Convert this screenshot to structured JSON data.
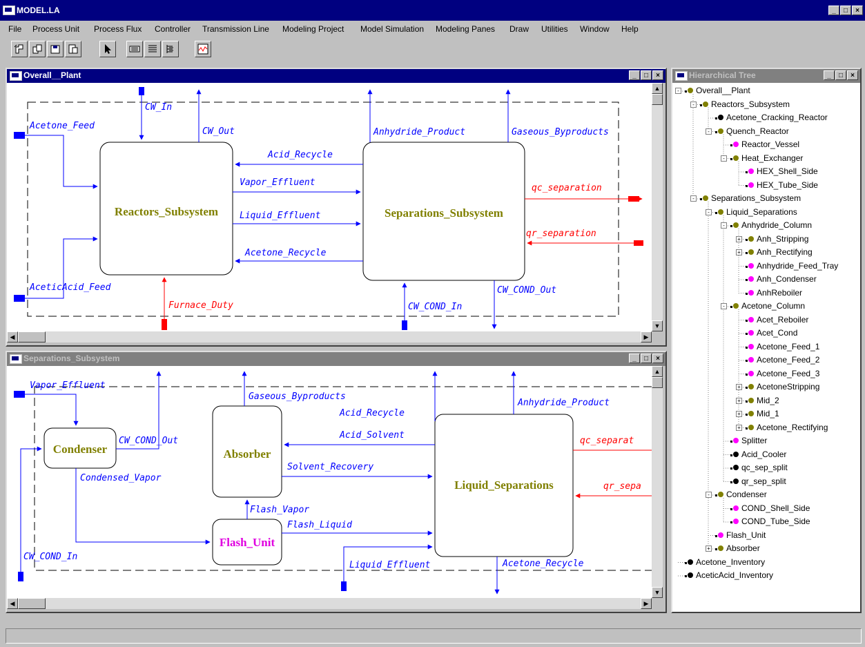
{
  "app": {
    "title": "MODEL.LA"
  },
  "menu": [
    "File",
    "Process Unit",
    "Process Flux",
    "Controller",
    "Transmission Line",
    "Modeling Project",
    "Model Simulation",
    "Modeling Panes",
    "Draw",
    "Utilities",
    "Window",
    "Help"
  ],
  "toolbar": [
    "new-icon",
    "open-icon",
    "save-icon",
    "save-as-icon",
    "pointer-icon",
    "keyboard-icon",
    "list-icon",
    "tree-icon",
    "plot-icon"
  ],
  "colors": {
    "stream": "#0000ff",
    "energy": "#ff0000",
    "unit_label": "#808000",
    "flash_label": "#e000e0",
    "title_active": "#000080",
    "title_inactive": "#808080"
  },
  "win1": {
    "title": "Overall__Plant",
    "units": {
      "reactors": "Reactors_Subsystem",
      "separations": "Separations_Subsystem"
    },
    "streams": {
      "cw_in": "CW_In",
      "cw_out": "CW_Out",
      "acetone_feed": "Acetone_Feed",
      "aceticacid_feed": "AceticAcid_Feed",
      "furnace_duty": "Furnace_Duty",
      "acid_recycle": "Acid_Recycle",
      "vapor_effluent": "Vapor_Effluent",
      "liquid_effluent": "Liquid_Effluent",
      "acetone_recycle": "Acetone_Recycle",
      "anhydride_product": "Anhydride_Product",
      "gaseous_byproducts": "Gaseous_Byproducts",
      "qc_separation": "qc_separation",
      "qr_separation": "qr_separation",
      "cw_cond_in": "CW_COND_In",
      "cw_cond_out": "CW_COND_Out"
    }
  },
  "win2": {
    "title": "Separations_Subsystem",
    "units": {
      "condenser": "Condenser",
      "absorber": "Absorber",
      "flash": "Flash_Unit",
      "liquid_sep": "Liquid_Separations"
    },
    "streams": {
      "vapor_effluent": "Vapor_Effluent",
      "gaseous_byproducts": "Gaseous_Byproducts",
      "acid_recycle": "Acid_Recycle",
      "anhydride_product": "Anhydride_Product",
      "cw_cond_out": "CW_COND_Out",
      "acid_solvent": "Acid_Solvent",
      "qc_separat": "qc_separat",
      "condensed_vapor": "Condensed_Vapor",
      "solvent_recovery": "Solvent_Recovery",
      "qr_sepa": "qr_sepa",
      "flash_vapor": "Flash_Vapor",
      "flash_liquid": "Flash_Liquid",
      "cw_cond_in": "CW_COND_In",
      "liquid_effluent": "Liquid_Effluent",
      "acetone_recycle": "Acetone_Recycle"
    }
  },
  "tree": {
    "title": "Hierarchical Tree",
    "nodes": [
      {
        "label": "Overall__Plant",
        "level": 0,
        "color": "#808000",
        "expanded": true
      },
      {
        "label": "Reactors_Subsystem",
        "level": 1,
        "color": "#808000",
        "expanded": true
      },
      {
        "label": "Acetone_Cracking_Reactor",
        "level": 2,
        "color": "#000000"
      },
      {
        "label": "Quench_Reactor",
        "level": 2,
        "color": "#808000",
        "expanded": true
      },
      {
        "label": "Reactor_Vessel",
        "level": 3,
        "color": "#ff00ff"
      },
      {
        "label": "Heat_Exchanger",
        "level": 3,
        "color": "#808000",
        "expanded": true
      },
      {
        "label": "HEX_Shell_Side",
        "level": 4,
        "color": "#ff00ff"
      },
      {
        "label": "HEX_Tube_Side",
        "level": 4,
        "color": "#ff00ff"
      },
      {
        "label": "Separations_Subsystem",
        "level": 1,
        "color": "#808000",
        "expanded": true
      },
      {
        "label": "Liquid_Separations",
        "level": 2,
        "color": "#808000",
        "expanded": true
      },
      {
        "label": "Anhydride_Column",
        "level": 3,
        "color": "#808000",
        "expanded": true
      },
      {
        "label": "Anh_Stripping",
        "level": 4,
        "color": "#808000",
        "collapsed": true
      },
      {
        "label": "Anh_Rectifying",
        "level": 4,
        "color": "#808000",
        "collapsed": true
      },
      {
        "label": "Anhydride_Feed_Tray",
        "level": 4,
        "color": "#ff00ff"
      },
      {
        "label": "Anh_Condenser",
        "level": 4,
        "color": "#ff00ff"
      },
      {
        "label": "AnhReboiler",
        "level": 4,
        "color": "#ff00ff"
      },
      {
        "label": "Acetone_Column",
        "level": 3,
        "color": "#808000",
        "expanded": true
      },
      {
        "label": "Acet_Reboiler",
        "level": 4,
        "color": "#ff00ff"
      },
      {
        "label": "Acet_Cond",
        "level": 4,
        "color": "#ff00ff"
      },
      {
        "label": "Acetone_Feed_1",
        "level": 4,
        "color": "#ff00ff"
      },
      {
        "label": "Acetone_Feed_2",
        "level": 4,
        "color": "#ff00ff"
      },
      {
        "label": "Acetone_Feed_3",
        "level": 4,
        "color": "#ff00ff"
      },
      {
        "label": "AcetoneStripping",
        "level": 4,
        "color": "#808000",
        "collapsed": true
      },
      {
        "label": "Mid_2",
        "level": 4,
        "color": "#808000",
        "collapsed": true
      },
      {
        "label": "Mid_1",
        "level": 4,
        "color": "#808000",
        "collapsed": true
      },
      {
        "label": "Acetone_Rectifying",
        "level": 4,
        "color": "#808000",
        "collapsed": true
      },
      {
        "label": "Splitter",
        "level": 3,
        "color": "#ff00ff"
      },
      {
        "label": "Acid_Cooler",
        "level": 3,
        "color": "#000000"
      },
      {
        "label": "qc_sep_split",
        "level": 3,
        "color": "#000000"
      },
      {
        "label": "qr_sep_split",
        "level": 3,
        "color": "#000000"
      },
      {
        "label": "Condenser",
        "level": 2,
        "color": "#808000",
        "expanded": true
      },
      {
        "label": "COND_Shell_Side",
        "level": 3,
        "color": "#ff00ff"
      },
      {
        "label": "COND_Tube_Side",
        "level": 3,
        "color": "#ff00ff"
      },
      {
        "label": "Flash_Unit",
        "level": 2,
        "color": "#ff00ff"
      },
      {
        "label": "Absorber",
        "level": 2,
        "color": "#808000",
        "collapsed": true
      },
      {
        "label": "Acetone_Inventory",
        "level": 0,
        "color": "#000000"
      },
      {
        "label": "AceticAcid_Inventory",
        "level": 0,
        "color": "#000000"
      }
    ]
  },
  "window_buttons": {
    "minimize": "_",
    "maximize": "□",
    "close": "×"
  },
  "status": {
    "text": ""
  }
}
